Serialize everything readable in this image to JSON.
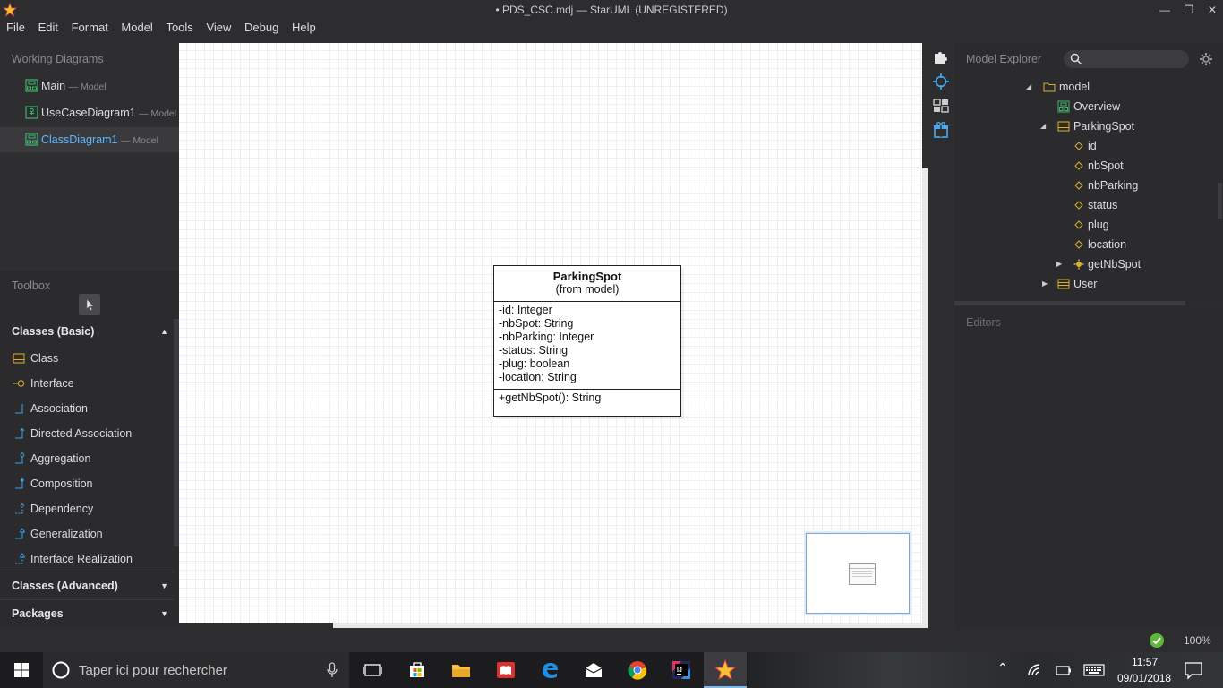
{
  "window": {
    "title": "• PDS_CSC.mdj — StarUML (UNREGISTERED)",
    "controls": [
      "minimize-icon",
      "restore-icon",
      "close-icon"
    ]
  },
  "menu": [
    "File",
    "Edit",
    "Format",
    "Model",
    "Tools",
    "View",
    "Debug",
    "Help"
  ],
  "working_diagrams": {
    "title": "Working Diagrams",
    "items": [
      {
        "label": "Main",
        "sub": "— Model"
      },
      {
        "label": "UseCaseDiagram1",
        "sub": "— Model"
      },
      {
        "label": "ClassDiagram1",
        "sub": "— Model",
        "active": true
      }
    ]
  },
  "toolbox": {
    "title": "Toolbox",
    "groups": [
      {
        "label": "Classes (Basic)",
        "expanded": true
      },
      {
        "label": "Classes (Advanced)",
        "expanded": false
      },
      {
        "label": "Packages",
        "expanded": false
      }
    ],
    "tools": [
      "Class",
      "Interface",
      "Association",
      "Directed Association",
      "Aggregation",
      "Composition",
      "Dependency",
      "Generalization",
      "Interface Realization"
    ]
  },
  "uml_class": {
    "name": "ParkingSpot",
    "stereotype": "(from model)",
    "attributes": [
      "-id: Integer",
      "-nbSpot: String",
      "-nbParking: Integer",
      "-status: String",
      "-plug: boolean",
      "-location: String"
    ],
    "operations": [
      "+getNbSpot(): String"
    ]
  },
  "model_explorer": {
    "title": "Model Explorer",
    "search_placeholder": "",
    "tree": [
      {
        "label": "model",
        "icon": "folder-icon",
        "arrow": "expanded"
      },
      {
        "label": "Overview",
        "icon": "diagram-icon",
        "arrow": ""
      },
      {
        "label": "ParkingSpot",
        "icon": "class-icon",
        "arrow": "expanded"
      },
      {
        "label": "id",
        "icon": "attribute-icon",
        "arrow": ""
      },
      {
        "label": "nbSpot",
        "icon": "attribute-icon",
        "arrow": ""
      },
      {
        "label": "nbParking",
        "icon": "attribute-icon",
        "arrow": ""
      },
      {
        "label": "status",
        "icon": "attribute-icon",
        "arrow": ""
      },
      {
        "label": "plug",
        "icon": "attribute-icon",
        "arrow": ""
      },
      {
        "label": "location",
        "icon": "attribute-icon",
        "arrow": ""
      },
      {
        "label": "getNbSpot",
        "icon": "operation-icon",
        "arrow": "collapsed"
      },
      {
        "label": "User",
        "icon": "class-icon",
        "arrow": "collapsed"
      }
    ]
  },
  "editors": {
    "title": "Editors"
  },
  "statusbar": {
    "zoom": "100%"
  },
  "taskbar": {
    "search_placeholder": "Taper ici pour rechercher",
    "time": "11:57",
    "date": "09/01/2018"
  },
  "colors": {
    "accent": "#5db7ff",
    "tool_icon": "#3aa0e6",
    "class_icon": "#d8b035",
    "diagram_icon": "#3fb56a"
  }
}
